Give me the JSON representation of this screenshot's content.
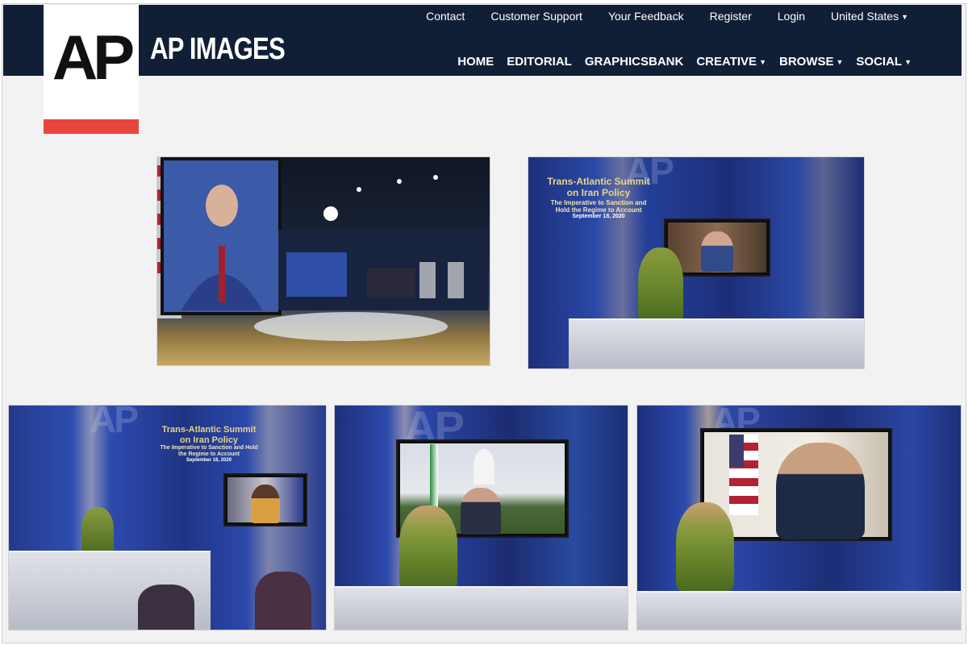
{
  "brand": {
    "logo_text": "AP",
    "name": "AP IMAGES",
    "colors": {
      "header_bg": "#111f36",
      "logo_accent": "#e8453c"
    }
  },
  "utility_nav": [
    {
      "label": "Contact"
    },
    {
      "label": "Customer Support"
    },
    {
      "label": "Your Feedback"
    },
    {
      "label": "Register"
    },
    {
      "label": "Login"
    },
    {
      "label": "United States",
      "icon": "caret-down-icon"
    }
  ],
  "main_nav": [
    {
      "label": "HOME"
    },
    {
      "label": "EDITORIAL"
    },
    {
      "label": "GRAPHICSBANK"
    },
    {
      "label": "CREATIVE",
      "icon": "caret-down-icon"
    },
    {
      "label": "BROWSE",
      "icon": "caret-down-icon"
    },
    {
      "label": "SOCIAL",
      "icon": "caret-down-icon"
    }
  ],
  "photos": {
    "watermark": "AP",
    "sign": {
      "line1": "Trans-Atlantic Summit",
      "line2": "on Iran Policy",
      "line3": "The Imperative to Sanction and Hold the Regime to Account",
      "line4": "September 18, 2020"
    }
  }
}
